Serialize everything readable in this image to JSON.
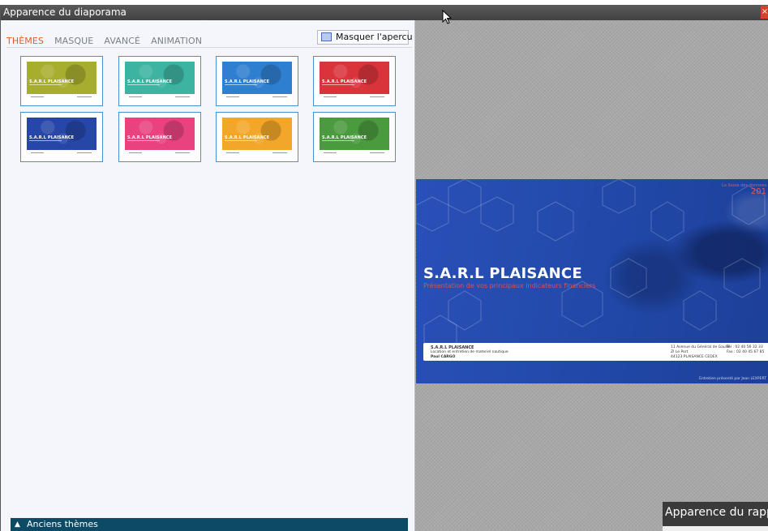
{
  "window": {
    "title": "Apparence du diaporama",
    "close_label": "×"
  },
  "tabs": [
    {
      "label": "THÈMES",
      "active": true
    },
    {
      "label": "MASQUE",
      "active": false
    },
    {
      "label": "AVANCÉ",
      "active": false
    },
    {
      "label": "ANIMATION",
      "active": false
    }
  ],
  "hide_preview_button": {
    "label": "Masquer l'apercu",
    "icon": "screen-icon"
  },
  "themes": [
    {
      "color": "#a7ad2e",
      "title": "S.A.R.L PLAISANCE"
    },
    {
      "color": "#3db3a1",
      "title": "S.A.R.L PLAISANCE"
    },
    {
      "color": "#2f7fd0",
      "title": "S.A.R.L PLAISANCE"
    },
    {
      "color": "#d9343c",
      "title": "S.A.R.L PLAISANCE"
    },
    {
      "color": "#2747a8",
      "title": "S.A.R.L PLAISANCE"
    },
    {
      "color": "#e8437f",
      "title": "S.A.R.L PLAISANCE"
    },
    {
      "color": "#f2a72a",
      "title": "S.A.R.L PLAISANCE"
    },
    {
      "color": "#4a9a3e",
      "title": "S.A.R.L PLAISANCE"
    }
  ],
  "old_themes": {
    "label": "Anciens thèmes",
    "icon": "triangle-up-icon"
  },
  "preview": {
    "top_right_small": "La liasse des donnees",
    "top_right_year": "201",
    "company": "S.A.R.L PLAISANCE",
    "subtitle": "Présentation de vos principaux indicateurs financiers",
    "info_name": "S.A.R.L PLAISANCE",
    "info_desc": "Location et entretien de materiel nautique",
    "info_contact": "Paul CARGO",
    "info_addr1": "11 Avenue du Général de Gaulle",
    "info_addr2": "ZI Le Port",
    "info_addr3": "44123 PLAISANCE CEDEX",
    "info_tel": "Tél : 02 40 56 32 33",
    "info_fax": "Fax : 02 40 45 67 85",
    "footer_credit": "Entretien présenté par Jean LEXPERT"
  },
  "bottom_window": {
    "title": "Apparence du rapp"
  }
}
